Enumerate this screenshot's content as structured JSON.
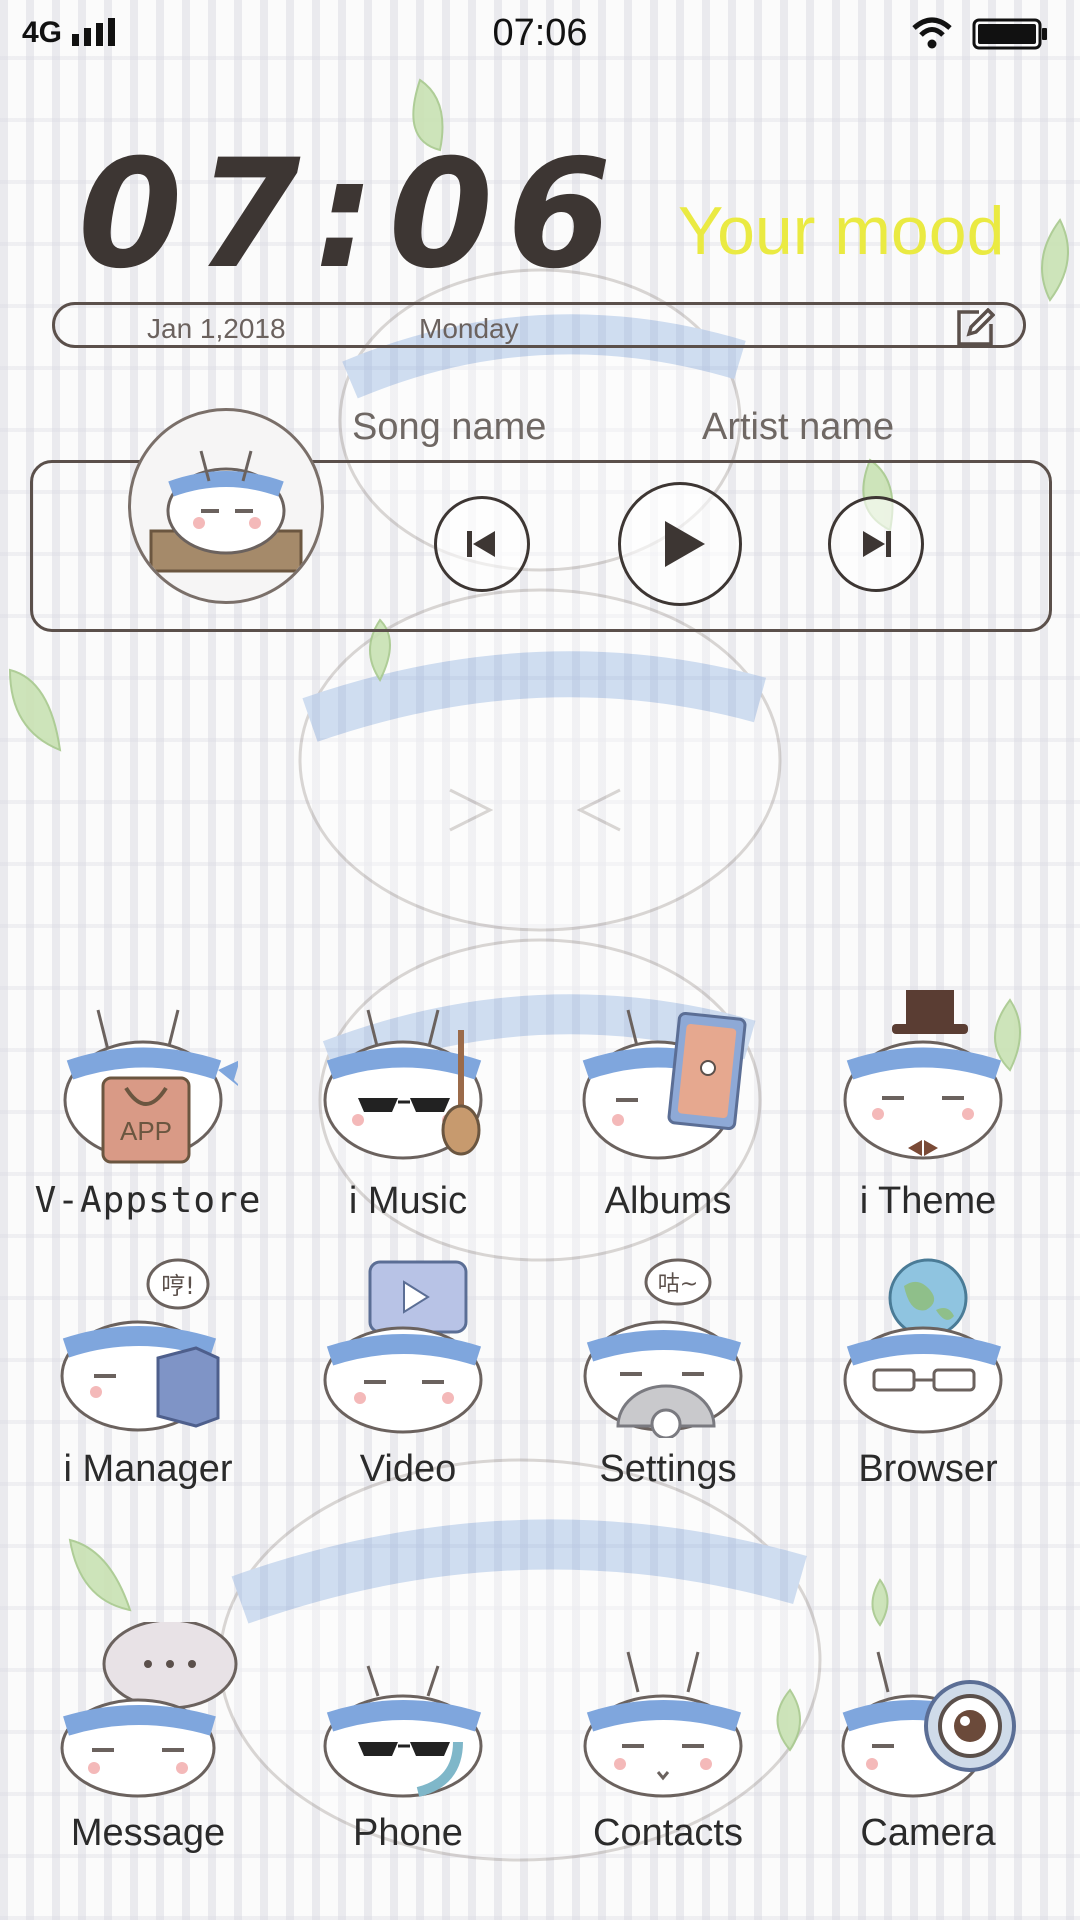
{
  "status_bar": {
    "network": "4G",
    "time": "07:06",
    "icons": [
      "signal-icon",
      "wifi-icon",
      "battery-icon"
    ]
  },
  "clock_widget": {
    "time": "07:06",
    "mood": "Your mood",
    "date": "Jan 1,2018",
    "weekday": "Monday",
    "edit_icon": "edit-icon"
  },
  "music_widget": {
    "song": "Song name",
    "artist": "Artist name",
    "controls": [
      "previous-icon",
      "play-icon",
      "next-icon"
    ]
  },
  "apps": [
    {
      "label": "V-Appstore",
      "icon": "appstore-icon",
      "prop": "APP"
    },
    {
      "label": "i Music",
      "icon": "music-icon"
    },
    {
      "label": "Albums",
      "icon": "albums-icon"
    },
    {
      "label": "i Theme",
      "icon": "theme-icon"
    },
    {
      "label": "i Manager",
      "icon": "manager-icon",
      "prop": "哼!"
    },
    {
      "label": "Video",
      "icon": "video-icon"
    },
    {
      "label": "Settings",
      "icon": "settings-icon",
      "prop": "咕~"
    },
    {
      "label": "Browser",
      "icon": "browser-icon"
    },
    {
      "label": "Message",
      "icon": "message-icon"
    },
    {
      "label": "Phone",
      "icon": "phone-icon"
    },
    {
      "label": "Contacts",
      "icon": "contacts-icon"
    },
    {
      "label": "Camera",
      "icon": "camera-icon"
    }
  ],
  "colors": {
    "text_dark": "#3d3633",
    "mood": "#eaea42",
    "headband": "#7fa6dd",
    "outline": "#5b504b",
    "leaf": "#b9d9a0"
  }
}
